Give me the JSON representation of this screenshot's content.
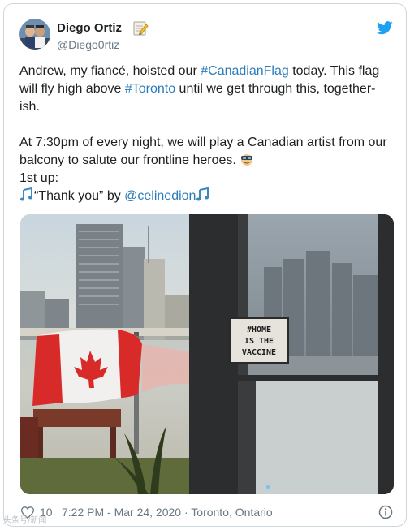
{
  "tweet": {
    "author_name": "Diego Ortiz",
    "author_handle": "@Diego0rtiz",
    "name_emoji_icon": "memo-icon",
    "body": {
      "line1_pre": "Andrew, my fiancé, hoisted our ",
      "line1_tag": "#CanadianFlag",
      "line1_post": " today. This flag",
      "line2_pre": "will fly high above ",
      "line2_tag": "#Toronto",
      "line2_post": " until we get through this, together-",
      "line3": "ish.",
      "line4": "At 7:30pm of every night, we will play a Canadian artist from our",
      "line5": "balcony to salute our frontline heroes.",
      "line6": "1st up:",
      "line7_quote": "“Thank you” by ",
      "line7_mention": "@celinedion"
    },
    "photo_sign_lines": [
      "#HOME",
      "IS THE",
      "VACCINE"
    ],
    "likes_count": "10",
    "timestamp": "7:22 PM - Mar 24, 2020",
    "separator": " · ",
    "location": "Toronto, Ontario"
  },
  "watermark": "头条号/新闻",
  "colors": {
    "link": "#2b7bb9",
    "twitter_blue": "#1da1f2",
    "muted": "#697882",
    "border": "#ccd6dd"
  }
}
